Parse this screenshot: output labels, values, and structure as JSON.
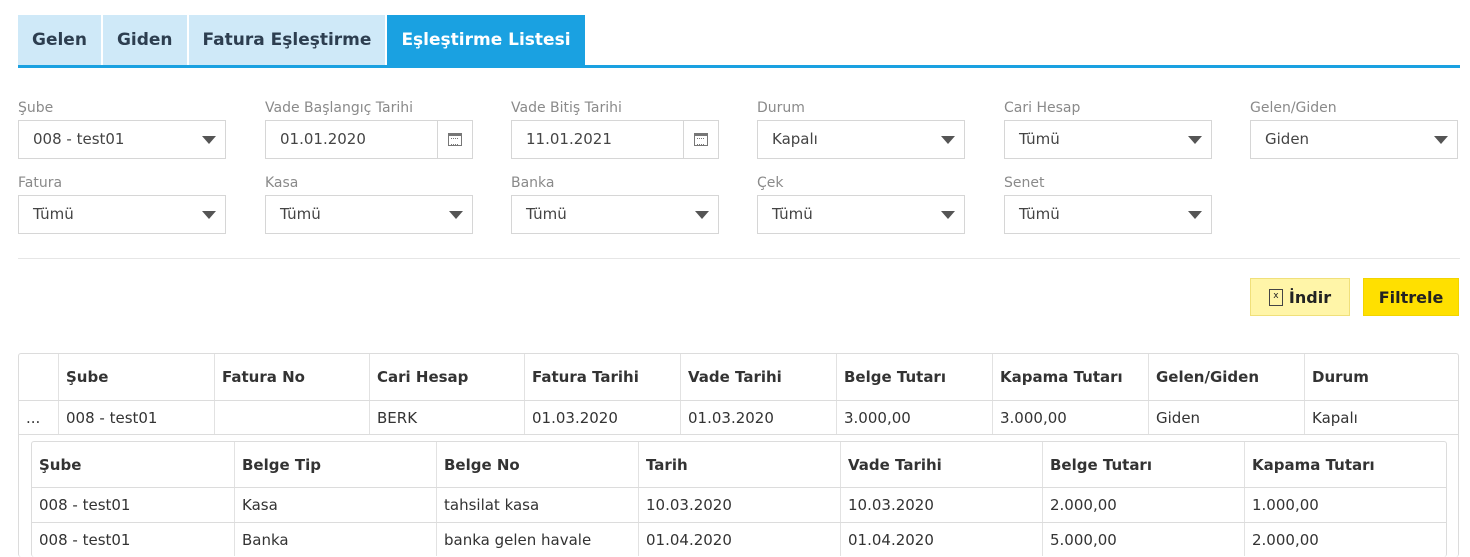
{
  "tabs": [
    "Gelen",
    "Giden",
    "Fatura Eşleştirme",
    "Eşleştirme Listesi"
  ],
  "filters": {
    "sube": {
      "label": "Şube",
      "value": "008 - test01"
    },
    "vade_baslangic": {
      "label": "Vade Başlangıç Tarihi",
      "value": "01.01.2020"
    },
    "vade_bitis": {
      "label": "Vade Bitiş Tarihi",
      "value": "11.01.2021"
    },
    "durum": {
      "label": "Durum",
      "value": "Kapalı"
    },
    "cari_hesap": {
      "label": "Cari Hesap",
      "value": "Tümü"
    },
    "gelen_giden": {
      "label": "Gelen/Giden",
      "value": "Giden"
    },
    "fatura": {
      "label": "Fatura",
      "value": "Tümü"
    },
    "kasa": {
      "label": "Kasa",
      "value": "Tümü"
    },
    "banka": {
      "label": "Banka",
      "value": "Tümü"
    },
    "cek": {
      "label": "Çek",
      "value": "Tümü"
    },
    "senet": {
      "label": "Senet",
      "value": "Tümü"
    }
  },
  "buttons": {
    "indir": "İndir",
    "filtrele": "Filtrele"
  },
  "main_table": {
    "columns": [
      "",
      "Şube",
      "Fatura No",
      "Cari Hesap",
      "Fatura Tarihi",
      "Vade Tarihi",
      "Belge Tutarı",
      "Kapama Tutarı",
      "Gelen/Giden",
      "Durum"
    ],
    "rows": [
      [
        "...",
        "008 - test01",
        "",
        "BERK",
        "01.03.2020",
        "01.03.2020",
        "3.000,00",
        "3.000,00",
        "Giden",
        "Kapalı"
      ]
    ]
  },
  "detail_table": {
    "columns": [
      "Şube",
      "Belge Tip",
      "Belge No",
      "Tarih",
      "Vade Tarihi",
      "Belge Tutarı",
      "Kapama Tutarı"
    ],
    "rows": [
      [
        "008 - test01",
        "Kasa",
        "tahsilat kasa",
        "10.03.2020",
        "10.03.2020",
        "2.000,00",
        "1.000,00"
      ],
      [
        "008 - test01",
        "Banka",
        "banka gelen havale",
        "01.04.2020",
        "01.04.2020",
        "5.000,00",
        "2.000,00"
      ]
    ]
  },
  "colors": {
    "accent": "#1aa1e1",
    "tab_inactive": "#cfe9f8",
    "filter_button": "#ffe000",
    "download_button": "#fff5a8"
  }
}
